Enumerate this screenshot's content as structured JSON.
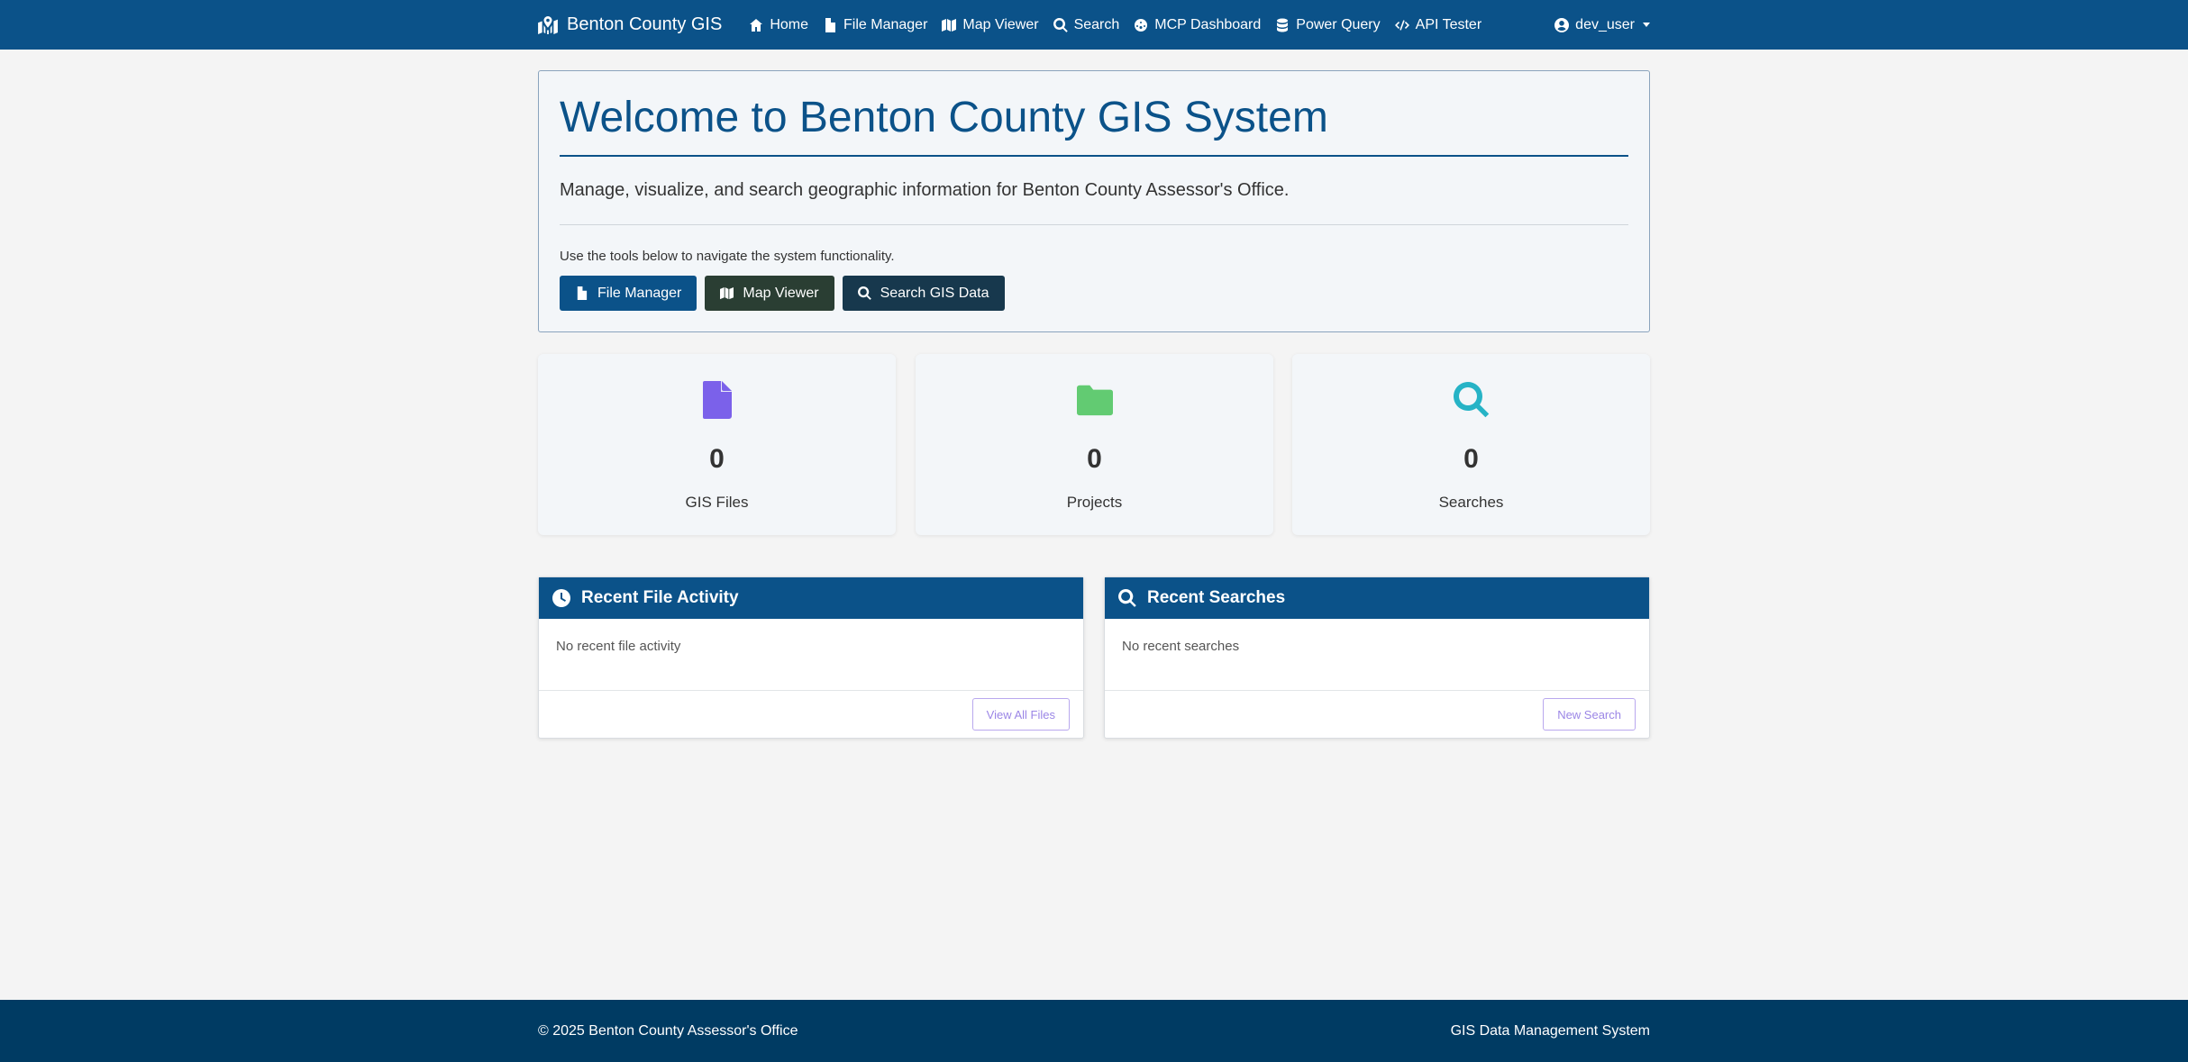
{
  "navbar": {
    "brand": "Benton County GIS",
    "links": [
      {
        "label": "Home",
        "icon": "home-icon"
      },
      {
        "label": "File Manager",
        "icon": "file-icon"
      },
      {
        "label": "Map Viewer",
        "icon": "map-icon"
      },
      {
        "label": "Search",
        "icon": "search-icon"
      },
      {
        "label": "MCP Dashboard",
        "icon": "dashboard-icon"
      },
      {
        "label": "Power Query",
        "icon": "database-icon"
      },
      {
        "label": "API Tester",
        "icon": "code-icon"
      }
    ],
    "user": "dev_user"
  },
  "welcome": {
    "title": "Welcome to Benton County GIS System",
    "lead": "Manage, visualize, and search geographic information for Benton County Assessor's Office.",
    "hint": "Use the tools below to navigate the system functionality.",
    "buttons": [
      {
        "label": "File Manager",
        "icon": "file-icon"
      },
      {
        "label": "Map Viewer",
        "icon": "map-icon"
      },
      {
        "label": "Search GIS Data",
        "icon": "search-icon"
      }
    ]
  },
  "stats": [
    {
      "value": "0",
      "label": "GIS Files",
      "icon": "file-icon",
      "color": "#7b61ea"
    },
    {
      "value": "0",
      "label": "Projects",
      "icon": "folder-icon",
      "color": "#62cb72"
    },
    {
      "value": "0",
      "label": "Searches",
      "icon": "search-icon",
      "color": "#26b3c6"
    }
  ],
  "recent_files": {
    "title": "Recent File Activity",
    "empty": "No recent file activity",
    "action": "View All Files"
  },
  "recent_searches": {
    "title": "Recent Searches",
    "empty": "No recent searches",
    "action": "New Search"
  },
  "footer": {
    "copyright": "© 2025 Benton County Assessor's Office",
    "system": "GIS Data Management System"
  },
  "colors": {
    "primary": "#0b5289",
    "footer": "#003b63",
    "background": "#f4f4f4"
  }
}
